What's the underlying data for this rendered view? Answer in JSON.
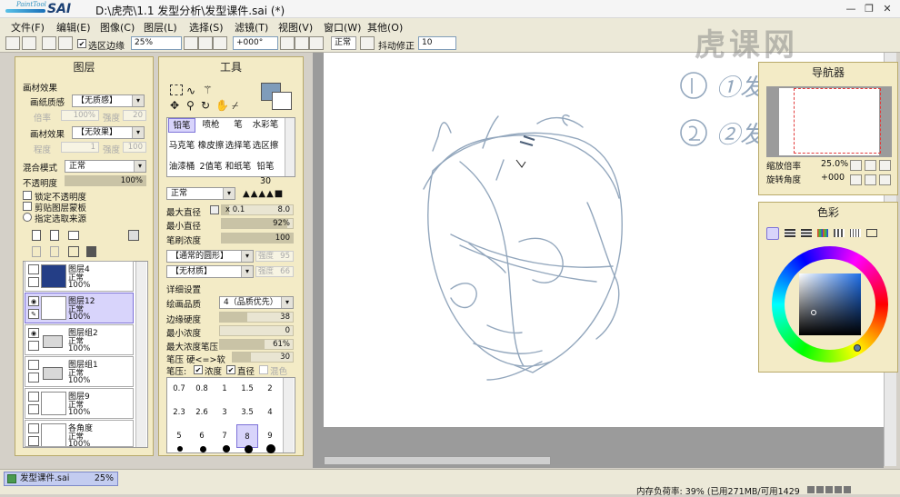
{
  "app": {
    "title": "D:\\虎壳\\1.1 发型分析\\发型课件.sai (*)",
    "logo_small": "PaintTool",
    "logo_big": "SAI"
  },
  "menu": [
    "文件(F)",
    "编辑(E)",
    "图像(C)",
    "图层(L)",
    "选择(S)",
    "滤镜(T)",
    "视图(V)",
    "窗口(W)",
    "其他(O)"
  ],
  "toolbar": {
    "selection_edge_label": "选区边缘",
    "zoom": "25%",
    "rotation": "+000°",
    "blend": "正常",
    "stabilizer_label": "抖动修正",
    "stabilizer": "10"
  },
  "layers_panel": {
    "title": "图层",
    "paper_effect_label": "画材效果",
    "paper_texture_label": "画纸质感",
    "paper_texture_value": "【无质感】",
    "ratio_label": "倍率",
    "ratio_value": "100%",
    "intensity_label": "强度",
    "intensity_value": "20",
    "material_effect_label": "画材效果",
    "material_effect_value": "【无效果】",
    "degree_label": "程度",
    "degree_value": "1",
    "intensity2_label": "强度",
    "intensity2_value": "100",
    "blend_label": "混合模式",
    "blend_value": "正常",
    "opacity_label": "不透明度",
    "opacity_value": "100%",
    "lock_opacity": "锁定不透明度",
    "clip_mask": "剪贴图层蒙板",
    "select_source": "指定选取来源",
    "layers": [
      {
        "name": "图层4",
        "mode": "正常",
        "opacity": "100%"
      },
      {
        "name": "图层12",
        "mode": "正常",
        "opacity": "100%"
      },
      {
        "name": "图层组2",
        "mode": "正常",
        "opacity": "100%"
      },
      {
        "name": "图层组1",
        "mode": "正常",
        "opacity": "100%"
      },
      {
        "name": "图层9",
        "mode": "正常",
        "opacity": "100%"
      },
      {
        "name": "各角度",
        "mode": "正常",
        "opacity": "100%"
      }
    ]
  },
  "tools_panel": {
    "title": "工具",
    "brushes": [
      "铅笔",
      "喷枪",
      "笔",
      "水彩笔",
      "马克笔",
      "橡皮擦",
      "选择笔",
      "选区擦",
      "油漆桶",
      "2值笔",
      "和纸笔",
      "铅笔30"
    ],
    "mode": "正常",
    "max_diameter_label": "最大直径",
    "max_diameter_mult": "x 0.1",
    "max_diameter_value": "8.0",
    "min_diameter_label": "最小直径",
    "min_diameter_value": "92%",
    "density_label": "笔刷浓度",
    "density_value": "100",
    "shape_value": "【通常的圆形】",
    "shape_strength_label": "强度",
    "shape_strength_value": "95",
    "texture_value": "【无材质】",
    "texture_strength_label": "强度",
    "texture_strength_value": "66",
    "detail_label": "详细设置",
    "quality_label": "绘画品质",
    "quality_value": "4（品质优先）",
    "edge_label": "边缘硬度",
    "edge_value": "38",
    "min_density_label": "最小浓度",
    "min_density_value": "0",
    "max_density_label": "最大浓度笔压",
    "max_density_value": "61%",
    "pressure_label": "笔压 硬<=>软",
    "pressure_value": "30",
    "pressure_opts_label": "笔压:",
    "opt_density": "浓度",
    "opt_diameter": "直径",
    "opt_blend": "混色",
    "sizes": [
      "0.7",
      "0.8",
      "1",
      "1.5",
      "2",
      "2.3",
      "2.6",
      "3",
      "3.5",
      "4",
      "5",
      "6",
      "7",
      "8",
      "9"
    ]
  },
  "canvas": {
    "handwriting_1": "①发",
    "handwriting_2": "②发际"
  },
  "navigator": {
    "title": "导航器",
    "zoom_label": "缩放倍率",
    "zoom_value": "25.0%",
    "rotate_label": "旋转角度",
    "rotate_value": "+000"
  },
  "color_panel": {
    "title": "色彩"
  },
  "status": {
    "file_name": "发型课件.sai",
    "file_zoom": "25%",
    "memory": "内存负荷率: 39% (已用271MB/可用1429MB)"
  },
  "watermark": "虎课网"
}
